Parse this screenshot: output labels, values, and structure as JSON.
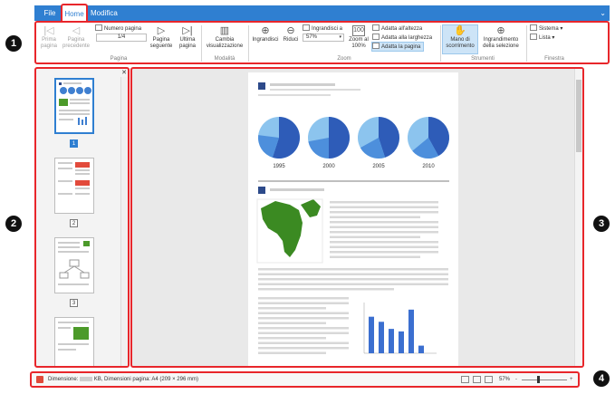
{
  "tabs": {
    "file": "File",
    "home": "Home",
    "modifica": "Modifica"
  },
  "ribbon": {
    "pagina": {
      "first_page": "Prima\npagina",
      "prev_page": "Pagina\nprecedente",
      "page_number_label": "Numero pagina",
      "page_number_value": "1/4",
      "next_page": "Pagina\nseguente",
      "last_page": "Ultima\npagina",
      "group_label": "Pagina"
    },
    "modalita": {
      "change_view": "Cambia\nvisualizzazione",
      "group_label": "Modalità"
    },
    "zoom": {
      "zoom_in": "Ingrandisci",
      "zoom_out": "Riduci",
      "zoom_to_label": "Ingrandisci a",
      "zoom_value": "57%",
      "zoom_100": "Zoom al\n100%",
      "fit_height": "Adatta all'altezza",
      "fit_width": "Adatta alla larghezza",
      "fit_page": "Adatta la pagina",
      "group_label": "Zoom"
    },
    "strumenti": {
      "hand": "Mano di\nscorrimento",
      "zoom_selection": "Ingrandimento\ndella selezione",
      "group_label": "Strumenti"
    },
    "finestra": {
      "sistema": "Sistema",
      "lista": "Lista",
      "group_label": "Finestra"
    }
  },
  "thumbnails": [
    {
      "page": "1",
      "selected": true
    },
    {
      "page": "2",
      "selected": false
    },
    {
      "page": "3",
      "selected": false
    }
  ],
  "document": {
    "pie_years": [
      "1995",
      "2000",
      "2005",
      "2010"
    ],
    "bar_values": [
      72,
      62,
      48,
      43,
      86,
      15
    ]
  },
  "status": {
    "size_label": "Dimensione:",
    "size_unit": "KB,",
    "page_dims": "Dimensioni pagina: A4 (209 × 296 mm)",
    "zoom_value": "57%"
  },
  "callouts": [
    "1",
    "2",
    "3",
    "4"
  ],
  "colors": {
    "accent": "#2f7fd1",
    "highlight": "#e8262b"
  }
}
